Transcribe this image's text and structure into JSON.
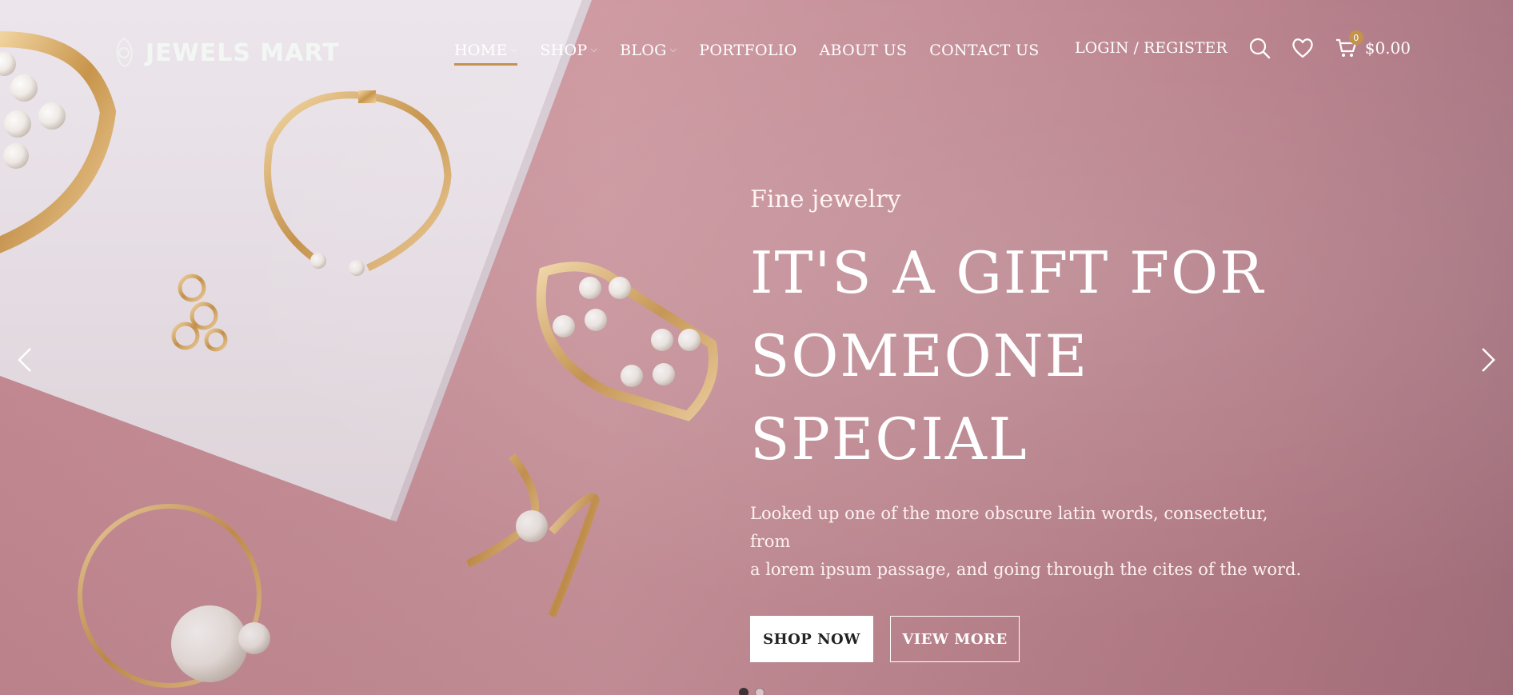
{
  "logo": {
    "text": "JEWELS MART"
  },
  "nav": [
    {
      "label": "HOME",
      "has_dropdown": true,
      "active": true
    },
    {
      "label": "SHOP",
      "has_dropdown": true
    },
    {
      "label": "BLOG",
      "has_dropdown": true
    },
    {
      "label": "PORTFOLIO"
    },
    {
      "label": "ABOUT US"
    },
    {
      "label": "CONTACT US"
    }
  ],
  "header": {
    "login_label": "LOGIN / REGISTER",
    "cart_count": "0",
    "cart_total": "$0.00",
    "icons": [
      "search-icon",
      "heart-icon",
      "cart-icon"
    ]
  },
  "slide": {
    "eyebrow": "Fine jewelry",
    "headline_line1": "IT'S A GIFT FOR",
    "headline_line2": "SOMEONE SPECIAL",
    "description_line1": "Looked up one of the more obscure latin words, consectetur, from",
    "description_line2": "a lorem ipsum passage, and going through the cites of the word.",
    "primary_button": "SHOP NOW",
    "secondary_button": "VIEW MORE"
  },
  "carousel": {
    "slide_count": 2,
    "active_index": 0
  },
  "colors": {
    "accent": "#c3924c",
    "background": "#c9929b",
    "panel": "#ece6ec"
  }
}
